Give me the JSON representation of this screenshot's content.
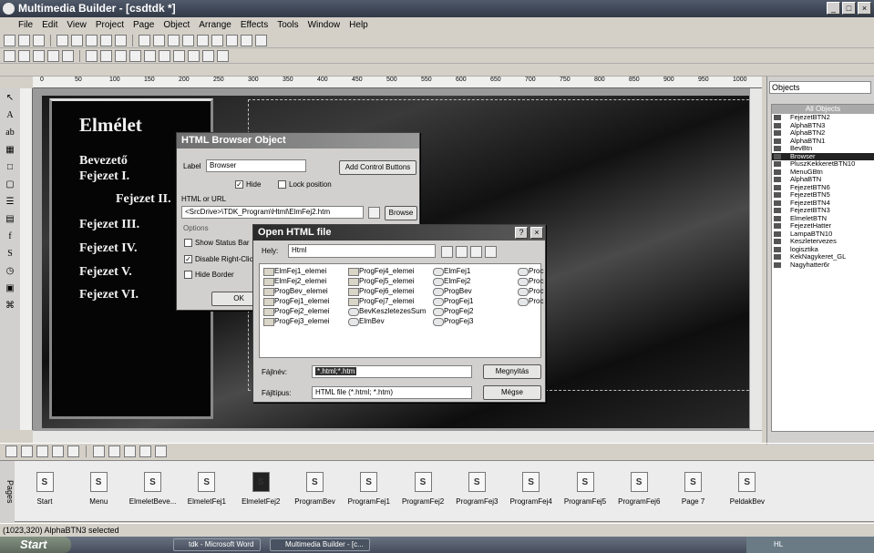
{
  "app": {
    "title": "Multimedia Builder - [csdtdk *]"
  },
  "menu": [
    "File",
    "Edit",
    "View",
    "Project",
    "Page",
    "Object",
    "Arrange",
    "Effects",
    "Tools",
    "Window",
    "Help"
  ],
  "ruler": {
    "ticks": [
      "0",
      "50",
      "100",
      "150",
      "200",
      "250",
      "300",
      "350",
      "400",
      "450",
      "500",
      "550",
      "600",
      "650",
      "700",
      "750",
      "800",
      "850",
      "900",
      "950",
      "1000"
    ]
  },
  "page_content": {
    "title": "Elmélet",
    "items": [
      "Bevezető",
      "Fejezet I.",
      "Fejezet II.",
      "Fejezet III.",
      "Fejezet IV.",
      "Fejezet V.",
      "Fejezet VI."
    ]
  },
  "browser_dialog": {
    "title": "HTML Browser Object",
    "label_caption": "Label",
    "label_value": "Browser",
    "add_control_buttons": "Add Control Buttons",
    "hide_label": "Hide",
    "hide_checked": true,
    "lock_position_label": "Lock position",
    "lock_checked": false,
    "html_url_label": "HTML or URL",
    "url_value": "<SrcDrive>\\TDK_Program\\Html\\ElmFej2.htm",
    "browse_label": "Browse",
    "options_label": "Options",
    "options": [
      {
        "label": "Show Status Bar",
        "checked": false
      },
      {
        "label": "Disable Right-Clic",
        "checked": true
      },
      {
        "label": "Hide Border",
        "checked": false
      }
    ],
    "ok_label": "OK"
  },
  "open_dialog": {
    "title": "Open HTML file",
    "look_in_label": "Hely:",
    "look_in_value": "Html",
    "files": [
      {
        "name": "ElmFej1_elemei",
        "kind": "folder"
      },
      {
        "name": "ElmFej2_elemei",
        "kind": "folder"
      },
      {
        "name": "ProgBev_elemei",
        "kind": "folder"
      },
      {
        "name": "ProgFej1_elemei",
        "kind": "folder"
      },
      {
        "name": "ProgFej2_elemei",
        "kind": "folder"
      },
      {
        "name": "ProgFej3_elemei",
        "kind": "folder"
      },
      {
        "name": "ProgFej4_elemei",
        "kind": "folder"
      },
      {
        "name": "ProgFej5_elemei",
        "kind": "folder"
      },
      {
        "name": "ProgFej6_elemei",
        "kind": "folder"
      },
      {
        "name": "ProgFej7_elemei",
        "kind": "folder"
      },
      {
        "name": "BevKeszletezesSum",
        "kind": "html"
      },
      {
        "name": "ElmBev",
        "kind": "html"
      },
      {
        "name": "ElmFej1",
        "kind": "html"
      },
      {
        "name": "ElmFej2",
        "kind": "html"
      },
      {
        "name": "ProgBev",
        "kind": "html"
      },
      {
        "name": "ProgFej1",
        "kind": "html"
      },
      {
        "name": "ProgFej2",
        "kind": "html"
      },
      {
        "name": "ProgFej3",
        "kind": "html"
      },
      {
        "name": "Proc",
        "kind": "html"
      },
      {
        "name": "Proc",
        "kind": "html"
      },
      {
        "name": "Proc",
        "kind": "html"
      },
      {
        "name": "Proc",
        "kind": "html"
      }
    ],
    "filename_label": "Fájlnév:",
    "filename_value": "*.html;*.htm",
    "filetype_label": "Fájltípus:",
    "filetype_value": "HTML file (*.html; *.htm)",
    "open_label": "Megnyitás",
    "cancel_label": "Mégse"
  },
  "objects_panel": {
    "title": "Objects",
    "header": "All Objects",
    "items": [
      "FejezetBTN2",
      "AlphaBTN3",
      "AlphaBTN2",
      "AlphaBTN1",
      "BevBtn",
      "Browser",
      "PluszKekkeretBTN10",
      "MenuGBtn",
      "AlphaBTN",
      "FejezetBTN6",
      "FejezetBTN5",
      "FejezetBTN4",
      "FejezetBTN3",
      "ElmeletBTN",
      "FejezetHatter",
      "LampaBTN10",
      "Keszletervezes",
      "logisztika",
      "KekNagykeret_GL",
      "Nagyhatter6r"
    ],
    "selected_index": 5
  },
  "pages": {
    "tab_label": "Pages",
    "items": [
      "Start",
      "Menu",
      "ElmeletBeve...",
      "ElmeletFej1",
      "ElmeletFej2",
      "ProgramBev",
      "ProgramFej1",
      "ProgramFej2",
      "ProgramFej3",
      "ProgramFej4",
      "ProgramFej5",
      "ProgramFej6",
      "Page 7",
      "PeldakBev"
    ]
  },
  "status": {
    "text": "(1023,320) AlphaBTN3 selected"
  },
  "taskbar": {
    "start_label": "Start",
    "tasks": [
      "tdk - Microsoft Word",
      "Multimedia Builder - [c..."
    ],
    "tray_text": "HL"
  }
}
